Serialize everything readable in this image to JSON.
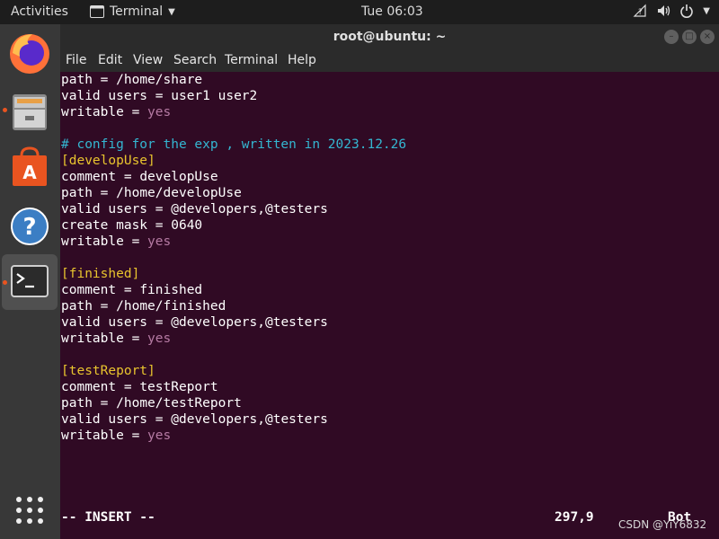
{
  "topbar": {
    "activities": "Activities",
    "app_name": "Terminal",
    "clock": "Tue 06:03"
  },
  "dock": {
    "items": [
      "firefox-icon",
      "files-icon",
      "software-icon",
      "help-icon",
      "terminal-icon"
    ]
  },
  "window": {
    "title": "root@ubuntu: ~",
    "menu": [
      "File",
      "Edit",
      "View",
      "Search",
      "Terminal",
      "Help"
    ]
  },
  "terminal": {
    "lines": [
      {
        "type": "kv",
        "key": "path",
        "op": " = ",
        "val": "/home/share",
        "val_style": "plain"
      },
      {
        "type": "kv",
        "key": "valid users",
        "op": " = ",
        "val": "user1 user2",
        "val_style": "plain"
      },
      {
        "type": "kv",
        "key": "writable",
        "op": " = ",
        "val": "yes",
        "val_style": "bool"
      },
      {
        "type": "blank"
      },
      {
        "type": "comment",
        "text": "# config for the exp , written in 2023.12.26"
      },
      {
        "type": "section",
        "text": "[developUse]"
      },
      {
        "type": "kv",
        "key": "comment",
        "op": " = ",
        "val": "developUse",
        "val_style": "plain"
      },
      {
        "type": "kv",
        "key": "path",
        "op": " = ",
        "val": "/home/developUse",
        "val_style": "plain"
      },
      {
        "type": "kv",
        "key": "valid users",
        "op": " = ",
        "val": "@developers,@testers",
        "val_style": "plain"
      },
      {
        "type": "kv",
        "key": "create mask",
        "op": " = ",
        "val": "0640",
        "val_style": "plain"
      },
      {
        "type": "kv",
        "key": "writable",
        "op": " = ",
        "val": "yes",
        "val_style": "bool"
      },
      {
        "type": "blank"
      },
      {
        "type": "section",
        "text": "[finished]"
      },
      {
        "type": "kv",
        "key": "comment",
        "op": " = ",
        "val": "finished",
        "val_style": "plain"
      },
      {
        "type": "kv",
        "key": "path",
        "op": " = ",
        "val": "/home/finished",
        "val_style": "plain"
      },
      {
        "type": "kv",
        "key": "valid users",
        "op": " = ",
        "val": "@developers,@testers",
        "val_style": "plain"
      },
      {
        "type": "kv",
        "key": "writable",
        "op": " = ",
        "val": "yes",
        "val_style": "bool"
      },
      {
        "type": "blank"
      },
      {
        "type": "section",
        "text": "[testReport]"
      },
      {
        "type": "kv",
        "key": "comment",
        "op": " = ",
        "val": "testReport",
        "val_style": "plain"
      },
      {
        "type": "kv",
        "key": "path",
        "op": " = ",
        "val": "/home/testReport",
        "val_style": "plain"
      },
      {
        "type": "kv",
        "key": "valid users",
        "op": " = ",
        "val": "@developers,@testers",
        "val_style": "plain"
      },
      {
        "type": "kv",
        "key": "writable",
        "op": " = ",
        "val": "yes",
        "val_style": "bool"
      }
    ],
    "mode": "-- INSERT --",
    "position": "297,9",
    "scroll": "Bot"
  },
  "watermark": "CSDN @YiY6832",
  "colors": {
    "terminal_bg": "#300a24",
    "section": "#e9c42e",
    "comment": "#34b6d1",
    "bool": "#b57aa3",
    "ubuntu_orange": "#e95420"
  }
}
